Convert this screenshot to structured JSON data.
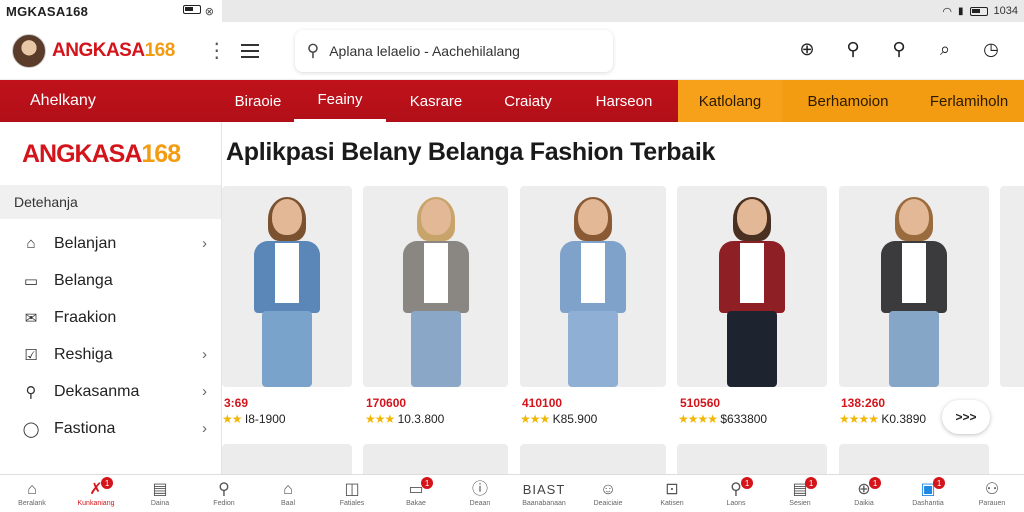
{
  "statusbar": {
    "time": "MGKASA168",
    "right_time": "1034"
  },
  "header": {
    "brand_main": "ANGKASA",
    "brand_num": "168",
    "search_text": "Aplana lelaelio - Aachehilalang",
    "icons": [
      "globe-icon",
      "search-icon",
      "search-alt-icon",
      "chat-icon",
      "clock-icon"
    ]
  },
  "nav": {
    "first": "Ahelkany",
    "tabs": [
      {
        "label": "Biraoie",
        "style": "normal"
      },
      {
        "label": "Feainy",
        "style": "active"
      },
      {
        "label": "Kasrare",
        "style": "normal"
      },
      {
        "label": "Craiaty",
        "style": "normal"
      },
      {
        "label": "Harseon",
        "style": "normal"
      },
      {
        "label": "Katlolang",
        "style": "orange"
      },
      {
        "label": "Berhamoion",
        "style": "orange2"
      },
      {
        "label": "Ferlamiholn",
        "style": "orange2"
      }
    ]
  },
  "sidebar": {
    "logo_main": "ANGKASA",
    "logo_num": "168",
    "field": "Detehanja",
    "items": [
      {
        "label": "Belanjan",
        "icon": "home-icon",
        "chevron": true
      },
      {
        "label": "Belanga",
        "icon": "card-icon",
        "chevron": false
      },
      {
        "label": "Fraakion",
        "icon": "mail-icon",
        "chevron": false
      },
      {
        "label": "Reshiga",
        "icon": "check-icon",
        "chevron": true
      },
      {
        "label": "Dekasanma",
        "icon": "search-icon",
        "chevron": true
      },
      {
        "label": "Fastiona",
        "icon": "circle-icon",
        "chevron": true
      }
    ]
  },
  "main": {
    "title": "Aplikpasi Belany Belanga Fashion Terbaik",
    "products": [
      {
        "price": "3:69",
        "rating": "I8-1900",
        "stars": "★★"
      },
      {
        "price": "170600",
        "rating": "10.3.800",
        "stars": "★★★"
      },
      {
        "price": "410100",
        "rating": "K85.900",
        "stars": "★★★"
      },
      {
        "price": "510560",
        "rating": "$633800",
        "stars": "★★★★"
      },
      {
        "price": "138:260",
        "rating": "K0.3890",
        "stars": "★★★★"
      }
    ],
    "next_label": ">>>"
  },
  "bottom": {
    "items": [
      {
        "label": "Beralank",
        "icon": "home-icon",
        "badge": ""
      },
      {
        "label": "Kunkaniang",
        "icon": "x-icon",
        "badge": "1",
        "active": true
      },
      {
        "label": "Daina",
        "icon": "doc-icon",
        "badge": ""
      },
      {
        "label": "Fedion",
        "icon": "search-icon",
        "badge": ""
      },
      {
        "label": "Baal",
        "icon": "home-icon",
        "badge": ""
      },
      {
        "label": "Fatiales",
        "icon": "book-icon",
        "badge": ""
      },
      {
        "label": "Bakae",
        "icon": "card-icon",
        "badge": "1"
      },
      {
        "label": "Deaan",
        "icon": "info-icon",
        "badge": ""
      },
      {
        "label": "Baanabanaan",
        "icon": "text-icon",
        "text": "BIAST",
        "badge": ""
      },
      {
        "label": "Deaiciaie",
        "icon": "face-icon",
        "badge": ""
      },
      {
        "label": "Katisen",
        "icon": "bag-icon",
        "badge": ""
      },
      {
        "label": "Laons",
        "icon": "search-icon",
        "badge": "1"
      },
      {
        "label": "Sesien",
        "icon": "doc-icon",
        "badge": "1"
      },
      {
        "label": "Daikia",
        "icon": "globe-icon",
        "badge": "1"
      },
      {
        "label": "Dashantia",
        "icon": "tablet-icon",
        "badge": "1",
        "blue": true
      },
      {
        "label": "Parauen",
        "icon": "user-icon",
        "badge": ""
      }
    ]
  }
}
